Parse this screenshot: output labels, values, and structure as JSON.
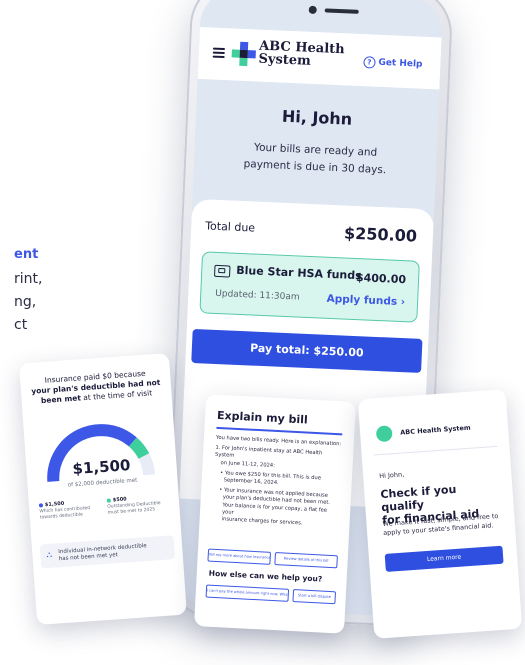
{
  "left_fragment": {
    "accent": "ent",
    "lines": [
      "rint,",
      "ng,",
      "ct"
    ]
  },
  "app": {
    "brand_line1": "ABC Health",
    "brand_line2": "System",
    "help_label": "Get Help",
    "greeting": "Hi, John",
    "subtitle_line1": "Your bills are ready and",
    "subtitle_line2": "payment is due in 30 days.",
    "total_label": "Total due",
    "total_amount": "$250.00",
    "hsa_name": "Blue Star HSA funds",
    "hsa_amount": "$400.00",
    "hsa_updated": "Updated: 11:30am",
    "apply_label": "Apply funds ›",
    "pay_label": "Pay total: $250.00"
  },
  "deductible_card": {
    "line1": "Insurance paid $0 because",
    "line2_bold": "your plan's deductible had not",
    "line3_bold": "been met",
    "line3_rest": " at the time of visit",
    "amount": "$1,500",
    "amount_sub": "of $2,000 deductible met",
    "legend1_value": "$1,500",
    "legend1_text": "Which has contributed towards deductible",
    "legend2_value": "$500",
    "legend2_text": "Outstanding Deductible must be met to 2025",
    "network_line1": "Individual in-network deductible",
    "network_line2": "has not been met yet",
    "met_fraction": 0.75,
    "color_met": "#3d57e6",
    "color_remaining": "#3fcf9c"
  },
  "explain_card": {
    "title": "Explain my bill",
    "intro": "You have two bills ready. Here is an explanation:",
    "item1_line1": "1.  For John's inpatient stay at ABC Health System",
    "item1_line2": "on June 11-12, 2024:",
    "bullet1_line1": "•  You owe $250 for this bill. This is due",
    "bullet1_line2": "September 16, 2024.",
    "bullet2_line1": "•  Your insurance was not applied because",
    "bullet2_line2": "your plan's deductible had not been met.",
    "bullet2_line3": "Your balance is for your copay, a flat fee your",
    "bullet2_line4": "insurance charges for services.",
    "btn1": "Tell me more about how insurance applied",
    "btn2": "Review details of this bill",
    "how_title": "How else can we help you?",
    "btn3": "I can't pay the whole amount right now. What are my options?",
    "btn4": "Start a bill dispute"
  },
  "aid_card": {
    "org": "ABC Health System",
    "hi": "Hi John,",
    "title_line1": "Check if you qualify",
    "title_line2": "for financial aid",
    "body_line1": "We make it fast, simple, and free to",
    "body_line2": "apply to your state's financial aid.",
    "cta": "Learn more"
  },
  "icons": {
    "menu": "hamburger-icon",
    "logo": "cross-logo-icon",
    "help": "question-circle-icon",
    "hsa": "wallet-icon",
    "network": "people-icon"
  }
}
